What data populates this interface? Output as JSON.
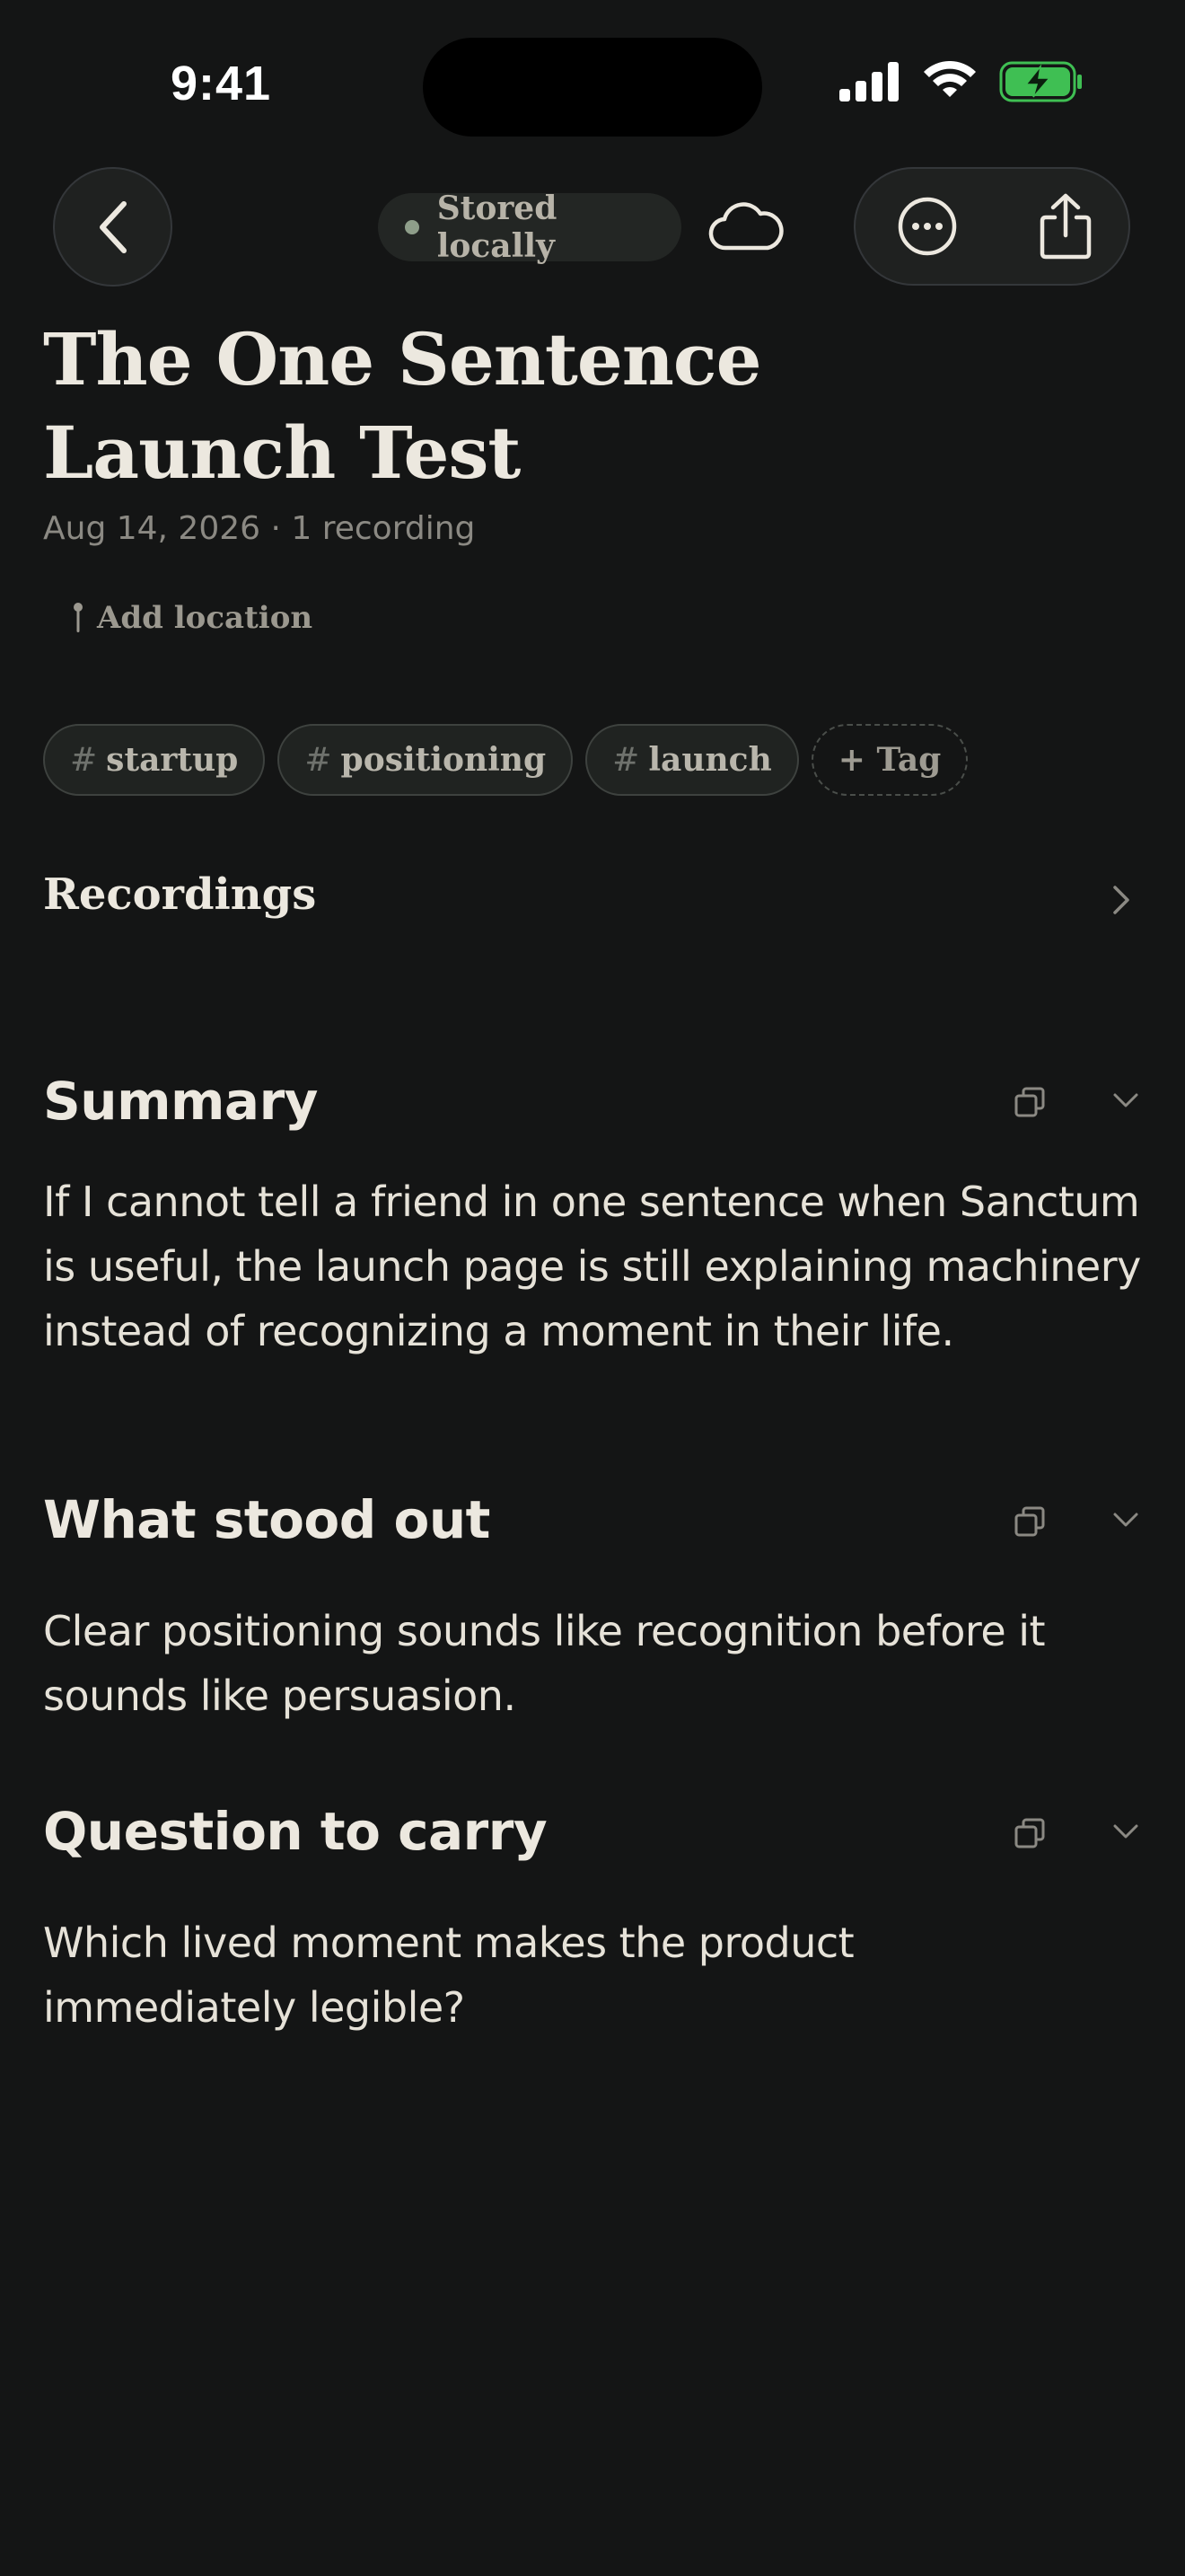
{
  "status_bar": {
    "time": "9:41"
  },
  "top_bar": {
    "back_icon": "chevron-left-icon",
    "storage_status": "Stored locally",
    "cloud_icon": "cloud-icon",
    "more_icon": "ellipsis-circle-icon",
    "share_icon": "share-icon"
  },
  "note": {
    "title": "The One Sentence Launch Test",
    "meta": "Aug 14, 2026 · 1 recording",
    "add_location": "Add location",
    "tags": [
      {
        "label": "startup"
      },
      {
        "label": "positioning"
      },
      {
        "label": "launch"
      }
    ],
    "add_tag": "+ Tag",
    "tag_hash": "#"
  },
  "recordings": {
    "title": "Recordings"
  },
  "sections": [
    {
      "heading": "Summary",
      "body": "If I cannot tell a friend in one sentence when Sanctum is useful, the launch page is still explaining machinery instead of recognizing a moment in their life."
    },
    {
      "heading": "What stood out",
      "body": "Clear positioning sounds like recognition before it sounds like persuasion."
    },
    {
      "heading": "Question to carry",
      "body": "Which lived moment makes the product immediately legible?"
    }
  ],
  "colors": {
    "background": "#141515",
    "text": "#ece8df",
    "muted": "#8b8983",
    "battery": "#3fbf53",
    "status_dot": "#8e9e8a"
  }
}
